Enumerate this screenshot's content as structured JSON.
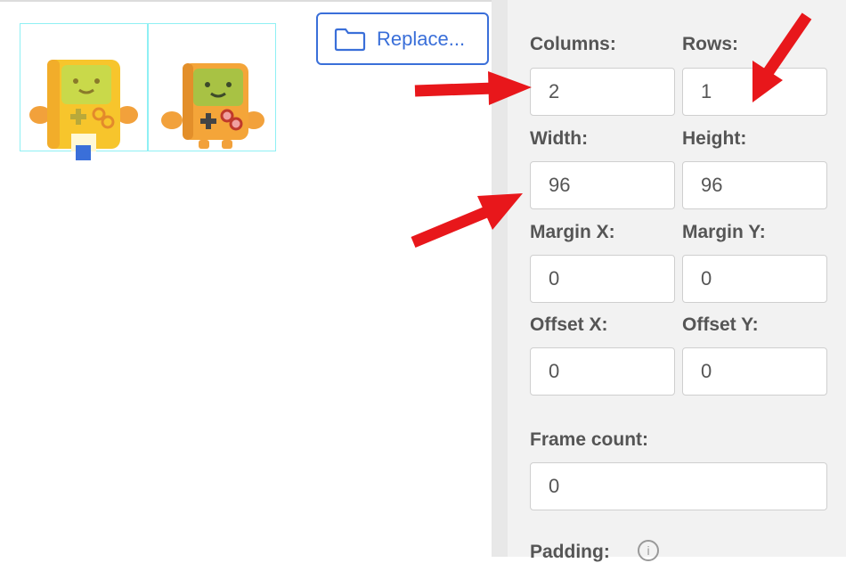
{
  "replace_button": {
    "label": "Replace..."
  },
  "panel": {
    "columns": {
      "label": "Columns:",
      "value": "2"
    },
    "rows": {
      "label": "Rows:",
      "value": "1"
    },
    "width": {
      "label": "Width:",
      "value": "96"
    },
    "height": {
      "label": "Height:",
      "value": "96"
    },
    "margin_x": {
      "label": "Margin X:",
      "value": "0"
    },
    "margin_y": {
      "label": "Margin Y:",
      "value": "0"
    },
    "offset_x": {
      "label": "Offset X:",
      "value": "0"
    },
    "offset_y": {
      "label": "Offset Y:",
      "value": "0"
    },
    "frame_count": {
      "label": "Frame count:",
      "value": "0"
    },
    "padding": {
      "label": "Padding:",
      "icon": "info-icon"
    }
  },
  "colors": {
    "accent": "#3a6fd9",
    "guide": "#8ff0f4",
    "arrow": "#e8171b"
  }
}
